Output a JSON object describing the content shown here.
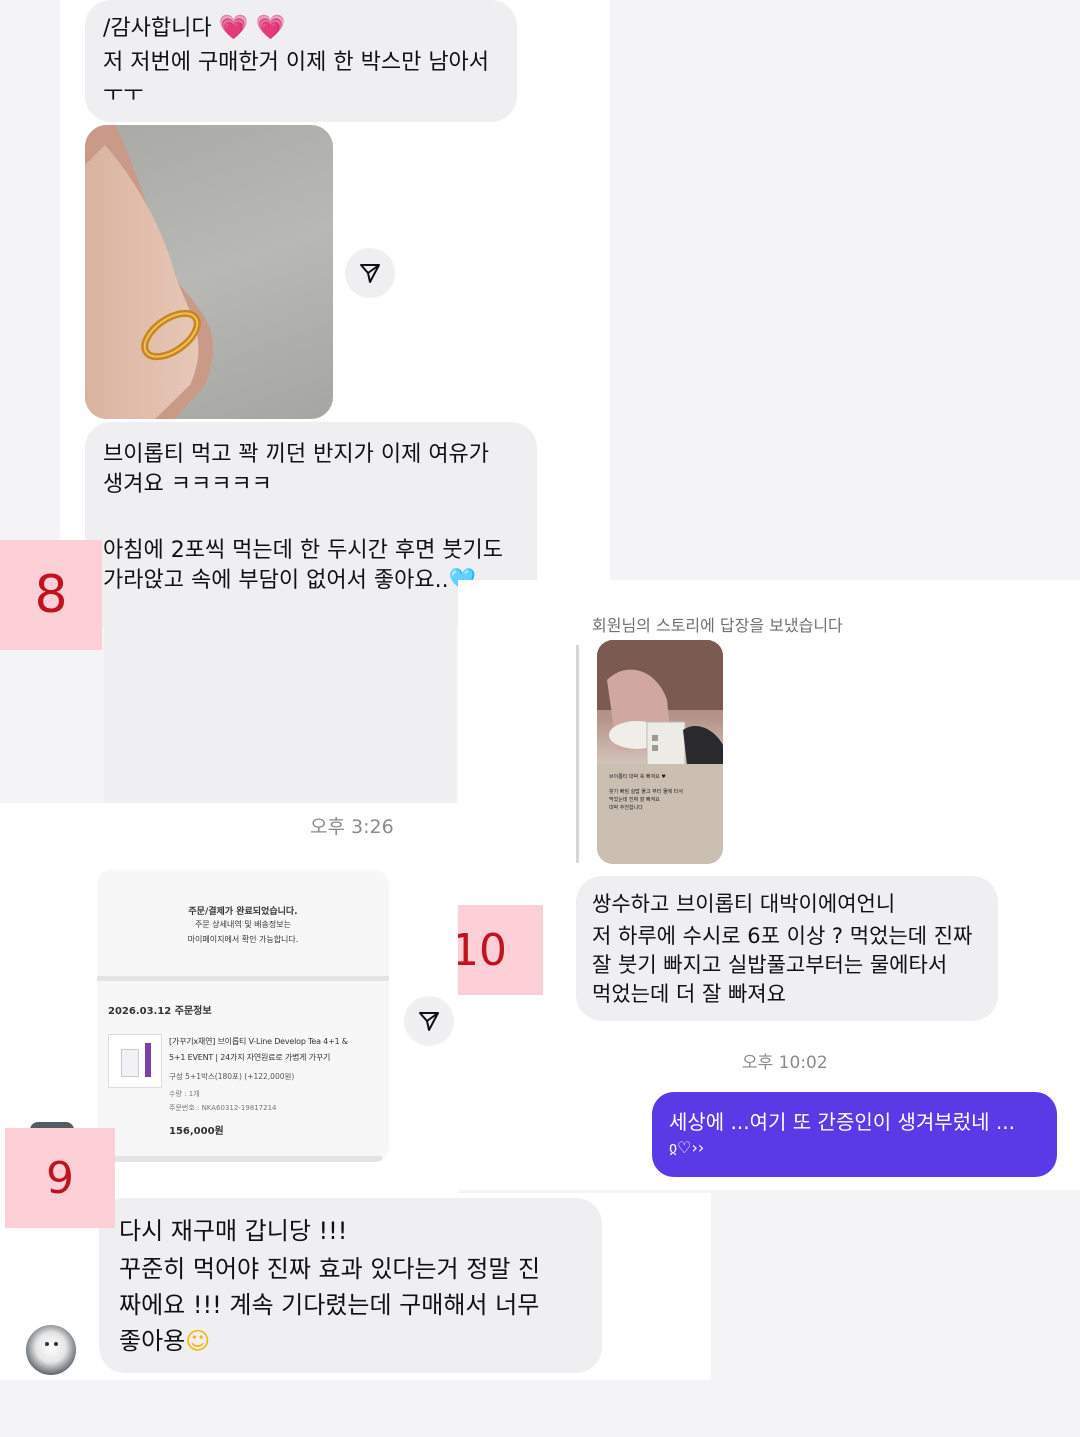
{
  "screen1": {
    "msg_top": {
      "line1": "/감사합니다",
      "line2": "저 저번에 구매한거 이제 한 박스만 남아서",
      "line3": "ㅜㅜ"
    },
    "msg_ring": {
      "line1": "브이롭티 먹고 꽉 끼던 반지가 이제 여유가",
      "line2": "생겨요 ㅋㅋㅋㅋㅋ",
      "line3": "아침에 2포씩 먹는데 한 두시간 후면 붓기도",
      "line4": "가라앉고 속에 부담이 없어서 좋아요.."
    },
    "time": "오후 3:26",
    "tag": "8"
  },
  "screen2": {
    "story_header": "회원님의 스토리에 답장을 보냈습니다",
    "story_caption": {
      "line1": "브이롭티 대박 쑥 빠져요 ♥",
      "line2": "붓기 빠짐 실밥 풀고 부터 물에 타서",
      "line3": "먹었는데 진짜 잘 빠져요",
      "line4": "대박 추천합니다"
    },
    "msg": {
      "line1": "쌍수하고 브이롭티 대박이에여언니",
      "line2": "저 하루에 수시로 6포 이상 ? 먹었는데 진짜",
      "line3": "잘 붓기 빠지고 실밥풀고부터는 물에타서",
      "line4": "먹었는데 더 잘 빠져요"
    },
    "time": "오후 10:02",
    "reply": {
      "text": "세상에 ...여기 또 간증인이 생겨부렀네 ...",
      "extra": "ჲ♡››"
    },
    "tag": "10"
  },
  "screen3": {
    "order": {
      "complete_title": "주문/결제가 완료되었습니다.",
      "complete_sub1": "주문 상세내역 및 배송정보는",
      "complete_sub2": "마이페이지에서 확인 가능합니다.",
      "info_title": "2026.03.12 주문정보",
      "product_line1": "[가꾸기x채연] 브이롭티 V-Line Develop Tea 4+1 &",
      "product_line2": "5+1 EVENT | 24가지 자연원료로 가볍게 가꾸기",
      "option": "구성 5+1박스(180포) (+122,000원)",
      "qty": "수량 : 1개",
      "order_no": "주문번호 : NKA60312-19817214",
      "price": "156,000원"
    },
    "msg": {
      "line1": "다시 재구매 갑니당 !!!",
      "line2": "꾸준히 먹어야 진짜 효과 있다는거 정말 진",
      "line3": "짜에요 !!! 계속 기다렸는데 구매해서 너무",
      "line4": "좋아용"
    },
    "tag": "9"
  },
  "icons": {
    "heart": "heart-emoji",
    "blue_heart": "blue-heart-emoji",
    "smile": "smiling-face-emoji",
    "send": "paper-plane-icon"
  },
  "colors": {
    "tag_bg": "#fcd0d6",
    "tag_text": "#c1121f",
    "bubble": "#efeff2",
    "outgoing": "#5a3ae6"
  }
}
